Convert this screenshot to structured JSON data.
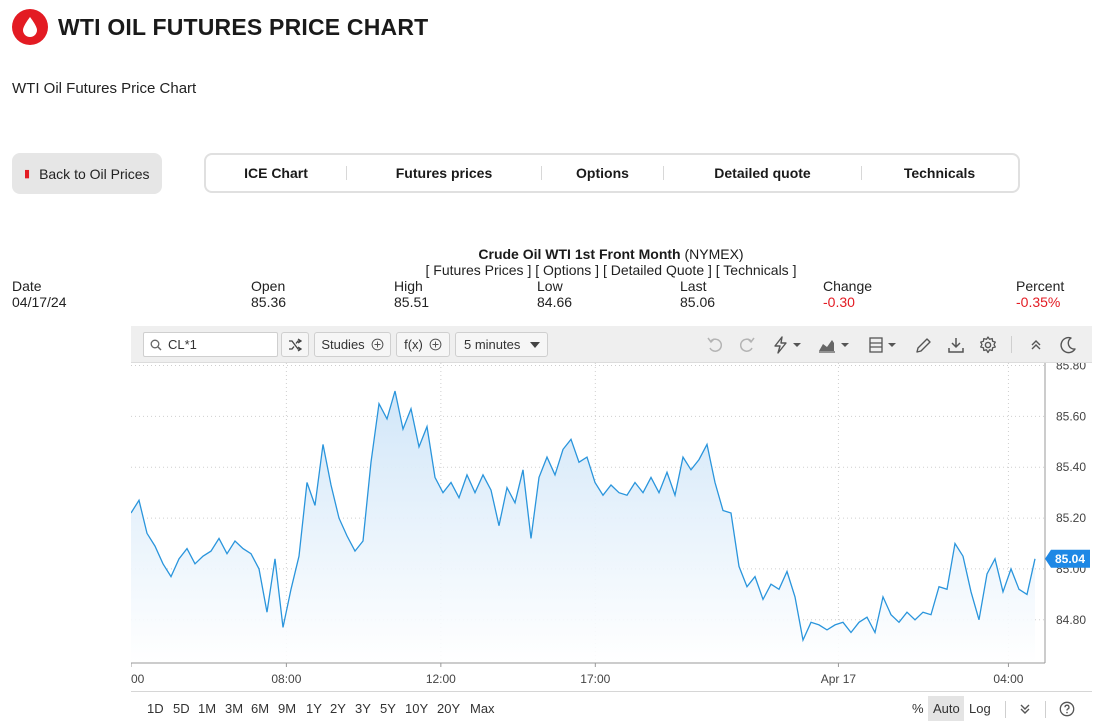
{
  "page": {
    "title": "WTI OIL FUTURES PRICE CHART",
    "subtitle": "WTI Oil Futures Price Chart",
    "logo_icon": "oil-drop-icon",
    "brand_color": "#e31b23"
  },
  "nav": {
    "back_label": "Back to Oil Prices",
    "tabs": [
      "ICE Chart",
      "Futures prices",
      "Options",
      "Detailed quote",
      "Technicals"
    ]
  },
  "quote": {
    "title_bold": "Crude Oil WTI 1st Front Month",
    "title_exchange": "(NYMEX)",
    "links": [
      "[ Futures Prices ]",
      "[ Options ]",
      "[ Detailed Quote ]",
      "[ Technicals ]"
    ],
    "date_label": "Date",
    "date": "04/17/24",
    "open_label": "Open",
    "open": "85.36",
    "high_label": "High",
    "high": "85.51",
    "low_label": "Low",
    "low": "84.66",
    "last_label": "Last",
    "last": "85.06",
    "change_label": "Change",
    "change": "-0.30",
    "percent_label": "Percent",
    "percent": "-0.35%"
  },
  "toolbar": {
    "symbol": "CL*1",
    "studies_label": "Studies",
    "fx_label": "f(x)",
    "interval_label": "5 minutes",
    "icons": [
      "search-icon",
      "shuffle-icon",
      "undo-icon",
      "redo-icon",
      "lightning-icon",
      "chart-type-icon",
      "layout-icon",
      "pencil-icon",
      "download-icon",
      "gear-icon",
      "collapse-icon",
      "dark-mode-icon"
    ]
  },
  "range_buttons": [
    "1D",
    "5D",
    "1M",
    "3M",
    "6M",
    "9M",
    "1Y",
    "2Y",
    "3Y",
    "5Y",
    "10Y",
    "20Y",
    "Max"
  ],
  "scale_options": [
    "%",
    "Auto",
    "Log"
  ],
  "chart_data": {
    "type": "area",
    "series": [
      {
        "values": [
          85.22,
          85.27,
          85.14,
          85.09,
          85.02,
          84.97,
          85.04,
          85.08,
          85.02,
          85.05,
          85.07,
          85.12,
          85.06,
          85.11,
          85.08,
          85.06,
          85.0,
          84.83,
          85.04,
          84.77,
          84.92,
          85.05,
          85.34,
          85.25,
          85.49,
          85.33,
          85.2,
          85.13,
          85.07,
          85.11,
          85.42,
          85.65,
          85.59,
          85.7,
          85.55,
          85.63,
          85.48,
          85.56,
          85.36,
          85.3,
          85.34,
          85.28,
          85.37,
          85.3,
          85.37,
          85.31,
          85.17,
          85.32,
          85.26,
          85.39,
          85.12,
          85.36,
          85.44,
          85.37,
          85.47,
          85.51,
          85.42,
          85.44,
          85.34,
          85.29,
          85.33,
          85.3,
          85.29,
          85.34,
          85.3,
          85.36,
          85.3,
          85.38,
          85.29,
          85.44,
          85.39,
          85.43,
          85.49,
          85.34,
          85.23,
          85.22,
          85.01,
          84.93,
          84.97,
          84.88,
          84.94,
          84.92,
          84.99,
          84.89,
          84.72,
          84.79,
          84.78,
          84.76,
          84.78,
          84.79,
          84.75,
          84.79,
          84.81,
          84.75,
          84.89,
          84.82,
          84.79,
          84.83,
          84.8,
          84.83,
          84.82,
          84.93,
          84.92,
          85.1,
          85.05,
          84.91,
          84.8,
          84.98,
          85.04,
          84.91,
          85.0,
          84.92,
          84.9,
          85.04
        ],
        "color": "#2a95dc"
      }
    ],
    "x_tick_labels": [
      "00",
      "08:00",
      "12:00",
      "17:00",
      "Apr 17",
      "04:00"
    ],
    "y_tick_labels": [
      "85.80",
      "85.60",
      "85.40",
      "85.20",
      "85.00",
      "84.80"
    ],
    "ylim": [
      84.63,
      85.81
    ],
    "last_value": 85.04,
    "last_label": "85.04",
    "grid": true
  }
}
